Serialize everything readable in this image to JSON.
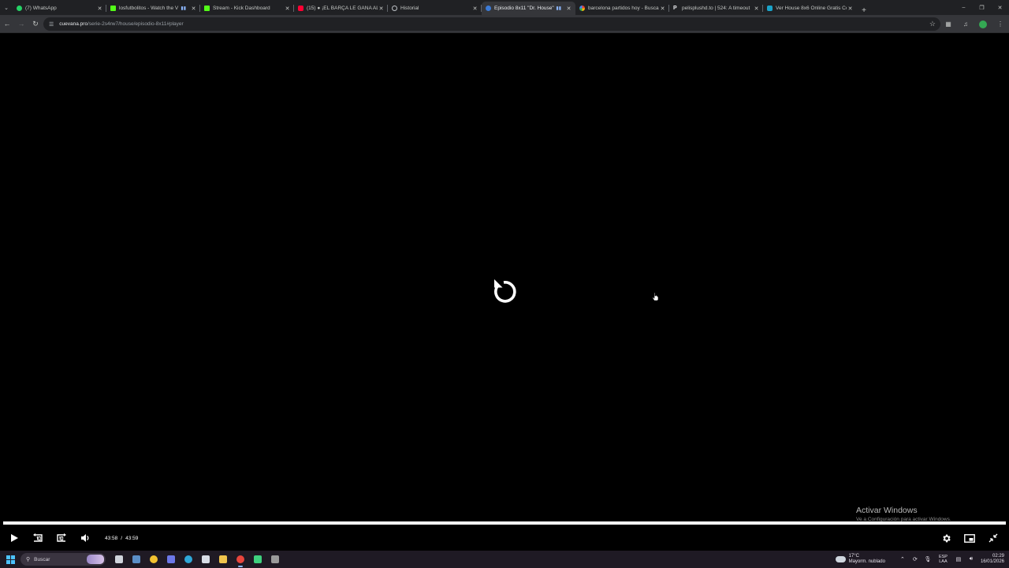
{
  "browser": {
    "tab_search_icon": "chevron-down-icon",
    "tabs": [
      {
        "title": "(7) WhatsApp",
        "favicon": "whatsapp-icon",
        "active": false
      },
      {
        "title": "losfutbolitos - Watch the V",
        "favicon": "kick-icon",
        "active": false,
        "audio": true
      },
      {
        "title": "Stream - Kick Dashboard",
        "favicon": "kick-icon",
        "active": false
      },
      {
        "title": "(15) ● ¡EL BARÇA LE GANA AL",
        "favicon": "youtube-icon",
        "active": false
      },
      {
        "title": "Historial",
        "favicon": "history-icon",
        "active": false
      },
      {
        "title": "Episodio 8x11 \"Dr. House\"",
        "favicon": "cuevana-icon",
        "active": true,
        "audio": true
      },
      {
        "title": "barcelona partidos hoy - Buscar",
        "favicon": "google-icon",
        "active": false
      },
      {
        "title": "pelisplushd.to | 524: A timeout",
        "favicon": "pelisplus-icon",
        "active": false
      },
      {
        "title": "Ver House 8x6 Online Gratis Co",
        "favicon": "verhouse-icon",
        "active": false
      }
    ],
    "new_tab_label": "+",
    "window_controls": {
      "minimize": "–",
      "restore": "❐",
      "close": "✕"
    },
    "address": {
      "host": "cuevana.pro",
      "path": "/serie-2s4rw7/house/episodio-8x11#player"
    }
  },
  "player": {
    "state": "ended",
    "center_icon": "replay-icon",
    "progress_fraction": 1.0,
    "current_time": "43:58",
    "separator": "/",
    "duration": "43:59",
    "controls_left": [
      "play-icon",
      "rewind-10-icon",
      "forward-10-icon",
      "volume-icon"
    ],
    "controls_right": [
      "settings-icon",
      "picture-in-picture-icon",
      "fullscreen-exit-icon"
    ]
  },
  "watermark": {
    "title": "Activar Windows",
    "subtitle": "Ve a Configuración para activar Windows."
  },
  "taskbar": {
    "search_placeholder": "Buscar",
    "apps": [
      {
        "icon": "task-view-icon",
        "color": "#cfd4dc"
      },
      {
        "icon": "steam-icon",
        "color": "#5b8fc7"
      },
      {
        "icon": "norton-icon",
        "color": "#f2c230"
      },
      {
        "icon": "discord-icon",
        "color": "#6c78e8"
      },
      {
        "icon": "edge-icon",
        "color": "#2fa8d8"
      },
      {
        "icon": "store-icon",
        "color": "#d8dde6"
      },
      {
        "icon": "file-explorer-icon",
        "color": "#f0c44c"
      },
      {
        "icon": "chrome-icon",
        "color": "#e8453c",
        "running": true
      },
      {
        "icon": "app-green-icon",
        "color": "#3fd17e"
      },
      {
        "icon": "app-obs-icon",
        "color": "#9a9a9a"
      }
    ],
    "weather": {
      "temp": "17°C",
      "desc": "Mayorm. nublado"
    },
    "lang": {
      "line1": "ESP",
      "line2": "LAA"
    },
    "clock": {
      "time": "02:29",
      "date": "16/01/2026"
    }
  }
}
